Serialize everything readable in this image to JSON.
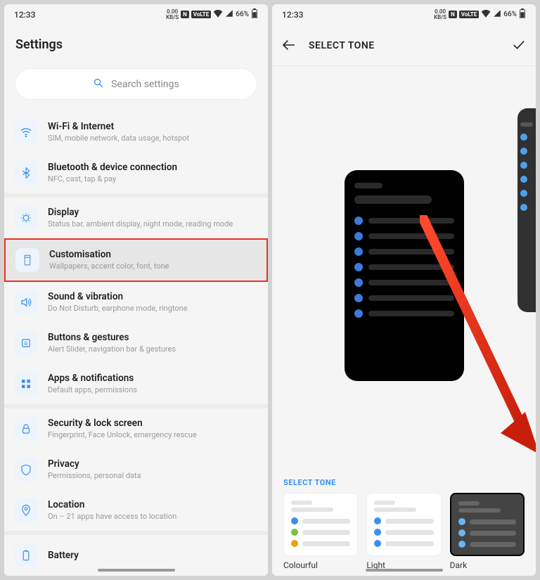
{
  "status": {
    "time": "12:33",
    "kbs_top": "0.00",
    "kbs_bot": "KB/S",
    "nfc": "N",
    "volte": "VoLTE",
    "battery": "66%"
  },
  "screen1": {
    "title": "Settings",
    "search_placeholder": "Search settings",
    "items": [
      {
        "title": "Wi-Fi & Internet",
        "sub": "SIM, mobile network, data usage, hotspot",
        "icon": "wifi"
      },
      {
        "title": "Bluetooth & device connection",
        "sub": "NFC, cast, tap & pay",
        "icon": "bluetooth"
      }
    ],
    "items2": [
      {
        "title": "Display",
        "sub": "Status bar, ambient display, night mode, reading mode",
        "icon": "display"
      },
      {
        "title": "Customisation",
        "sub": "Wallpapers, accent color, font, tone",
        "icon": "customisation",
        "highlight": true
      },
      {
        "title": "Sound & vibration",
        "sub": "Do Not Disturb, earphone mode, ringtone",
        "icon": "sound"
      },
      {
        "title": "Buttons & gestures",
        "sub": "Alert Slider, navigation bar & gestures",
        "icon": "buttons"
      },
      {
        "title": "Apps & notifications",
        "sub": "Default apps, permissions",
        "icon": "apps"
      }
    ],
    "items3": [
      {
        "title": "Security & lock screen",
        "sub": "Fingerprint, Face Unlock, emergency rescue",
        "icon": "security"
      },
      {
        "title": "Privacy",
        "sub": "Permissions, personal data",
        "icon": "privacy"
      },
      {
        "title": "Location",
        "sub": "On – 21 apps have access to location",
        "icon": "location"
      }
    ],
    "items4": [
      {
        "title": "Battery",
        "sub": "",
        "icon": "battery"
      }
    ]
  },
  "screen2": {
    "appbar_title": "SELECT TONE",
    "section_label": "SELECT TONE",
    "tones": [
      {
        "label": "Colourful",
        "kind": "colourful"
      },
      {
        "label": "Light",
        "kind": "light"
      },
      {
        "label": "Dark",
        "kind": "dark"
      }
    ]
  }
}
